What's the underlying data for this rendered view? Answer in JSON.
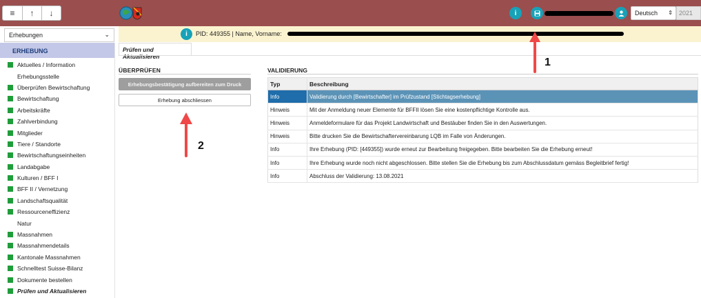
{
  "topbar": {
    "menu_icon": "≡",
    "up_icon": "↑",
    "down_icon": "↓",
    "logo": "logo-icon",
    "language": "Deutsch",
    "year": "2021"
  },
  "module_select": {
    "value": "Erhebungen"
  },
  "pid_bar": {
    "text": "PID: 449355 | Name, Vorname:"
  },
  "sidebar": {
    "heading": "ERHEBUNG",
    "items": [
      {
        "label": "Aktuelles / Information",
        "marker": true
      },
      {
        "label": "Erhebungsstelle",
        "marker": false
      },
      {
        "label": "Überprüfen Bewirtschaftung",
        "marker": true
      },
      {
        "label": "Bewirtschaftung",
        "marker": true
      },
      {
        "label": "Arbeitskräfte",
        "marker": true
      },
      {
        "label": "Zahlverbindung",
        "marker": true
      },
      {
        "label": "Mitglieder",
        "marker": true
      },
      {
        "label": "Tiere / Standorte",
        "marker": true
      },
      {
        "label": "Bewirtschaftungseinheiten",
        "marker": true
      },
      {
        "label": "Landabgabe",
        "marker": true
      },
      {
        "label": "Kulturen / BFF I",
        "marker": true
      },
      {
        "label": "BFF II / Vernetzung",
        "marker": true
      },
      {
        "label": "Landschaftsqualität",
        "marker": true
      },
      {
        "label": "Ressourceneffizienz",
        "marker": true
      },
      {
        "label": "Natur",
        "marker": false
      },
      {
        "label": "Massnahmen",
        "marker": true
      },
      {
        "label": "Massnahmendetails",
        "marker": true
      },
      {
        "label": "Kantonale Massnahmen",
        "marker": true
      },
      {
        "label": "Schnelltest Suisse-Bilanz",
        "marker": true
      },
      {
        "label": "Dokumente bestellen",
        "marker": true
      },
      {
        "label": "Prüfen und Aktualisieren",
        "marker": true,
        "active": true
      }
    ]
  },
  "tab": {
    "label": "Prüfen und Aktualisieren"
  },
  "ueberpruefen": {
    "title": "ÜBERPRÜFEN",
    "print_button": "Erhebungsbestätigung aufbereiten zum Druck",
    "close_button": "Erhebung abschliessen"
  },
  "validierung": {
    "title": "VALIDIERUNG",
    "columns": [
      "Typ",
      "Beschreibung"
    ],
    "rows": [
      {
        "typ": "Info",
        "text": "Validierung durch [Bewirtschafter] im Prüfzustand [Stichtagserhebung]",
        "selected": true
      },
      {
        "typ": "Hinweis",
        "text": "Mit der Anmeldung neuer Elemente für BFFII lösen Sie eine kostenpflichtige Kontrolle aus."
      },
      {
        "typ": "Hinweis",
        "text": "Anmeldeformulare für das Projekt Landwirtschaft und Bestäuber finden Sie in den Auswertungen."
      },
      {
        "typ": "Hinweis",
        "text": "Bitte drucken Sie die Bewirtschaftervereinbarung LQB im Falle von Änderungen."
      },
      {
        "typ": "Info",
        "text": "Ihre Erhebung (PID: [449355]) wurde erneut zur Bearbeitung freigegeben. Bitte bearbeiten Sie die Erhebung erneut!"
      },
      {
        "typ": "Info",
        "text": "Ihre Erhebung wurde noch nicht abgeschlossen. Bitte stellen Sie die Erhebung bis zum Abschlussdatum gemäss Begleitbrief fertig!"
      },
      {
        "typ": "Info",
        "text": "Abschluss der Validierung: 13.08.2021"
      }
    ]
  },
  "annotations": {
    "label_1": "1",
    "label_2": "2",
    "arrow_color": "#f04848"
  }
}
